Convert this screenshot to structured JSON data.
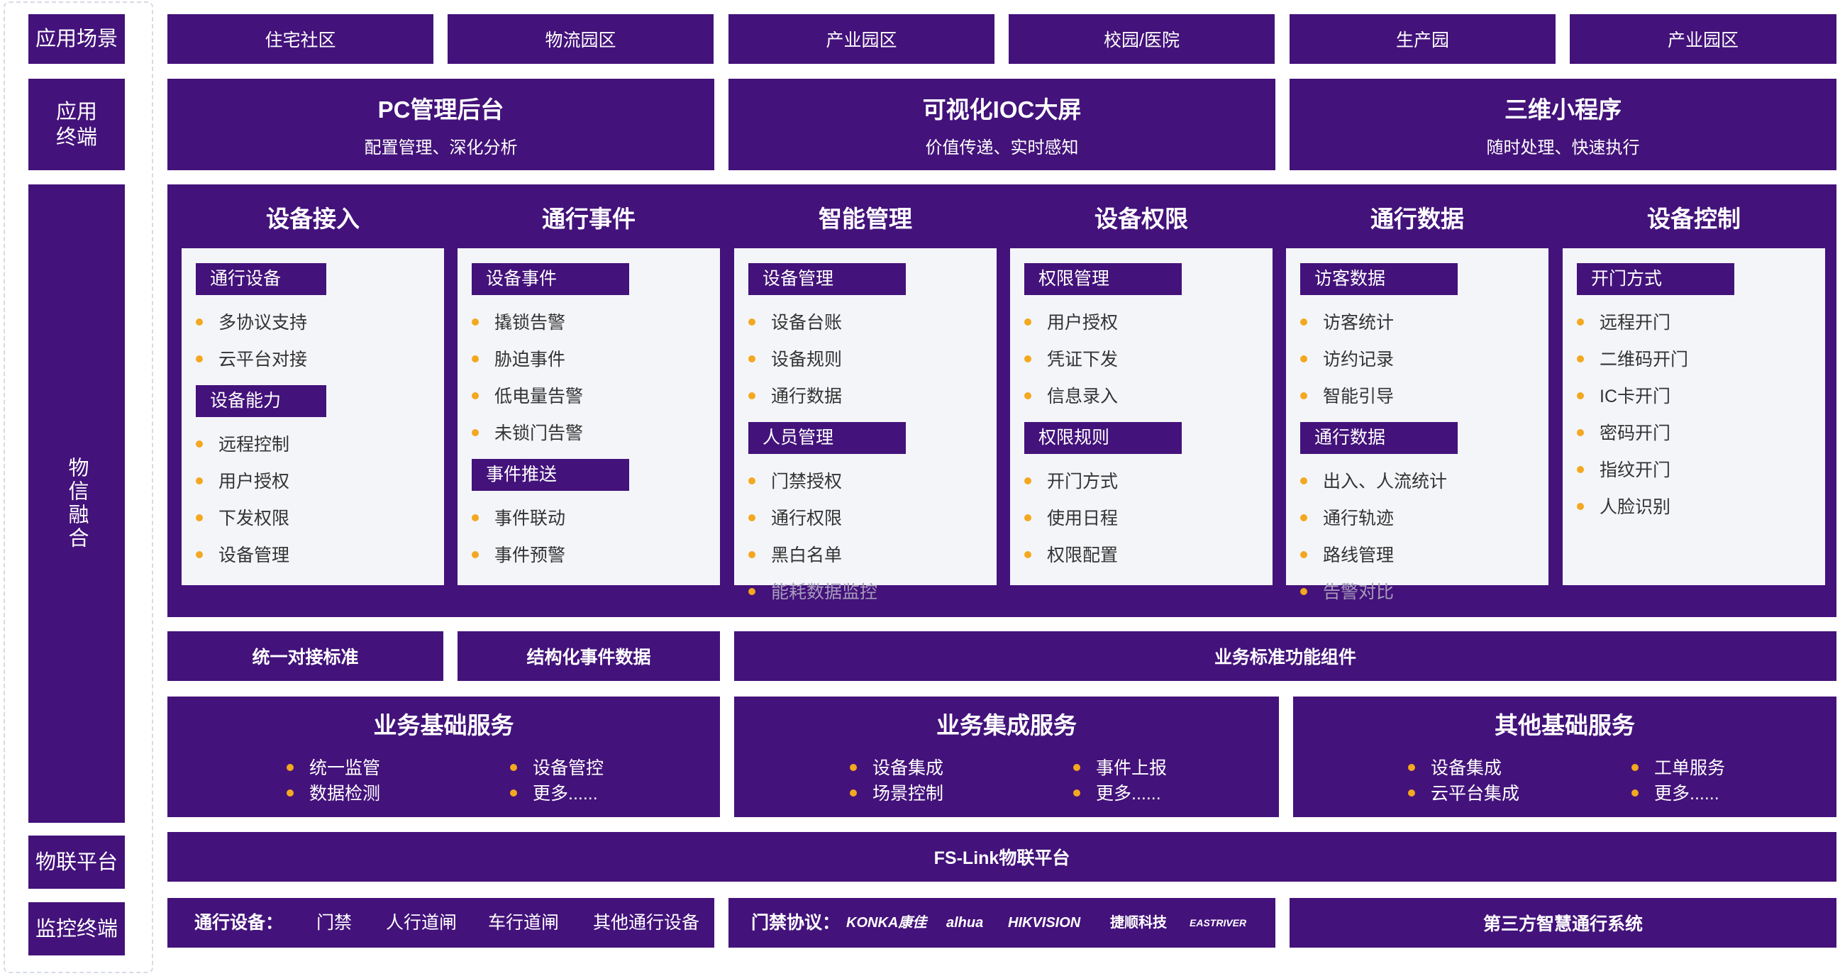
{
  "left_labels": {
    "scenes": "应用场景",
    "terminals": "应用终端",
    "fusion": "物信融合",
    "platform": "物联平台",
    "monitor": "监控终端"
  },
  "scenes": [
    "住宅社区",
    "物流园区",
    "产业园区",
    "校园/医院",
    "生产园",
    "产业园区"
  ],
  "terminals": [
    {
      "title": "PC管理后台",
      "sub": "配置管理、深化分析"
    },
    {
      "title": "可视化IOC大屏",
      "sub": "价值传递、实时感知"
    },
    {
      "title": "三维小程序",
      "sub": "随时处理、快速执行"
    }
  ],
  "categories": [
    {
      "title": "设备接入",
      "groups": [
        {
          "tag": "通行设备",
          "items": [
            "多协议支持",
            "云平台对接"
          ]
        },
        {
          "tag": "设备能力",
          "items": [
            "远程控制",
            "用户授权",
            "下发权限",
            "设备管理"
          ]
        }
      ],
      "overflow": []
    },
    {
      "title": "通行事件",
      "groups": [
        {
          "tag": "设备事件",
          "items": [
            "撬锁告警",
            "胁迫事件",
            "低电量告警",
            "未锁门告警"
          ]
        },
        {
          "tag": "事件推送",
          "items": [
            "事件联动",
            "事件预警"
          ]
        }
      ],
      "overflow": []
    },
    {
      "title": "智能管理",
      "groups": [
        {
          "tag": "设备管理",
          "items": [
            "设备台账",
            "设备规则",
            "通行数据"
          ]
        },
        {
          "tag": "人员管理",
          "items": [
            "门禁授权",
            "通行权限",
            "黑白名单"
          ]
        }
      ],
      "overflow": [
        "能耗数据监控"
      ]
    },
    {
      "title": "设备权限",
      "groups": [
        {
          "tag": "权限管理",
          "items": [
            "用户授权",
            "凭证下发",
            "信息录入"
          ]
        },
        {
          "tag": "权限规则",
          "items": [
            "开门方式",
            "使用日程",
            "权限配置"
          ]
        }
      ],
      "overflow": []
    },
    {
      "title": "通行数据",
      "groups": [
        {
          "tag": "访客数据",
          "items": [
            "访客统计",
            "访约记录",
            "智能引导"
          ]
        },
        {
          "tag": "通行数据",
          "items": [
            "出入、人流统计",
            "通行轨迹",
            "路线管理"
          ]
        }
      ],
      "overflow": [
        "告警对比"
      ]
    },
    {
      "title": "设备控制",
      "groups": [
        {
          "tag": "开门方式",
          "items": [
            "远程开门",
            "二维码开门",
            "IC卡开门",
            "密码开门",
            "指纹开门",
            "人脸识别"
          ]
        }
      ],
      "overflow": []
    }
  ],
  "standards": [
    "统一对接标准",
    "结构化事件数据",
    "业务标准功能组件"
  ],
  "services": [
    {
      "title": "业务基础服务",
      "left": [
        "统一监管",
        "数据检测"
      ],
      "right": [
        "设备管控",
        "更多......"
      ]
    },
    {
      "title": "业务集成服务",
      "left": [
        "设备集成",
        "场景控制"
      ],
      "right": [
        "事件上报",
        "更多......"
      ]
    },
    {
      "title": "其他基础服务",
      "left": [
        "设备集成",
        "云平台集成"
      ],
      "right": [
        "工单服务",
        "更多......"
      ]
    }
  ],
  "platform": "FS-Link物联平台",
  "monitor": {
    "devices_label": "通行设备：",
    "devices": [
      "门禁",
      "人行道闸",
      "车行道闸",
      "其他通行设备"
    ],
    "protocol_label": "门禁协议：",
    "protocols": [
      "KONKA康佳",
      "alhua",
      "HIKVISION",
      "捷顺科技",
      "EASTRIVER"
    ],
    "third_party": "第三方智慧通行系统"
  },
  "colors": {
    "primary": "#43127a",
    "card": "#f4f5f9",
    "bullet": "#f3a81f"
  }
}
